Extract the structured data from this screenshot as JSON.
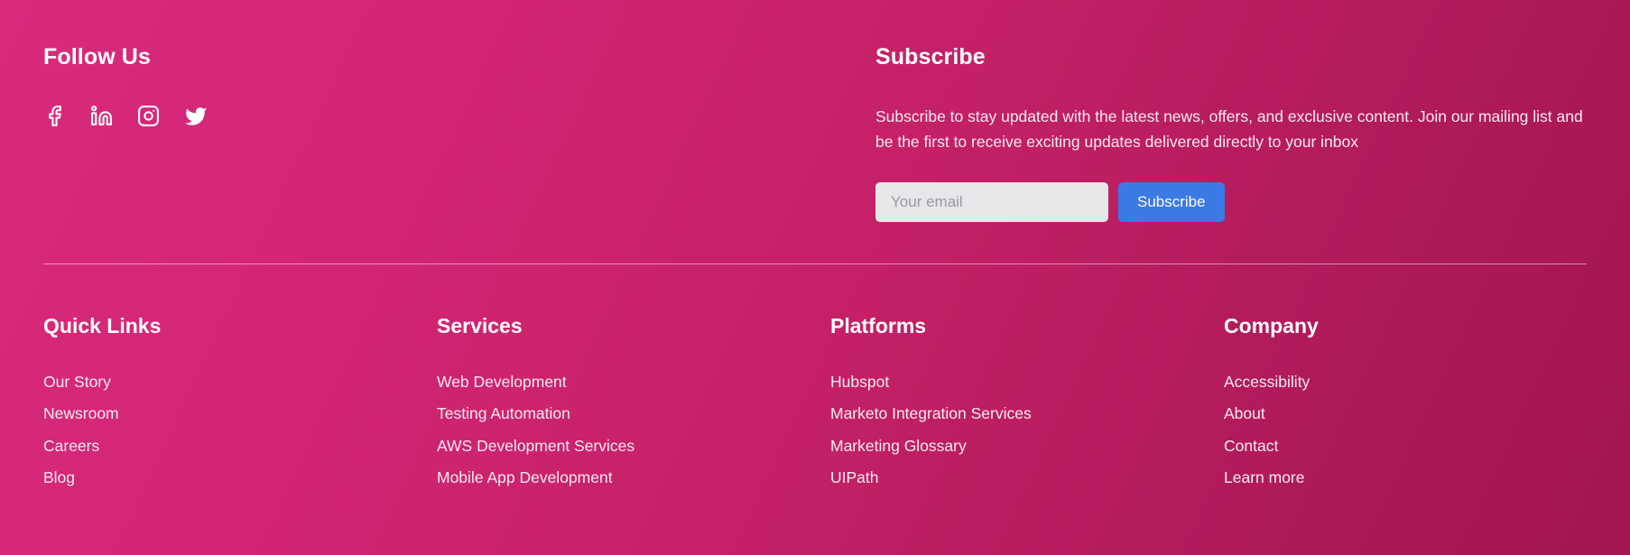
{
  "theme": {
    "bg_gradient_start": "#d92a7c",
    "bg_gradient_end": "#a21551",
    "text_color": "#ffffff",
    "link_color": "#fbeaf1",
    "button_color": "#3b7ae4",
    "input_bg": "#e6e7e9"
  },
  "follow": {
    "title": "Follow Us",
    "socials": [
      {
        "name": "facebook",
        "icon": "facebook-icon",
        "label": "Facebook"
      },
      {
        "name": "linkedin",
        "icon": "linkedin-icon",
        "label": "LinkedIn"
      },
      {
        "name": "instagram",
        "icon": "instagram-icon",
        "label": "Instagram"
      },
      {
        "name": "twitter",
        "icon": "twitter-icon",
        "label": "Twitter"
      }
    ]
  },
  "subscribe": {
    "title": "Subscribe",
    "description": "Subscribe to stay updated with the latest news, offers, and exclusive content. Join our mailing list and be the first to receive exciting updates delivered directly to your inbox",
    "email_placeholder": "Your email",
    "email_value": "",
    "button_label": "Subscribe"
  },
  "columns": [
    {
      "title": "Quick Links",
      "links": [
        "Our Story",
        "Newsroom",
        "Careers",
        "Blog"
      ]
    },
    {
      "title": "Services",
      "links": [
        "Web Development",
        "Testing Automation",
        "AWS Development Services",
        "Mobile App Development"
      ]
    },
    {
      "title": "Platforms",
      "links": [
        "Hubspot",
        "Marketo Integration Services",
        "Marketing Glossary",
        "UIPath"
      ]
    },
    {
      "title": "Company",
      "links": [
        "Accessibility",
        "About",
        "Contact",
        "Learn more"
      ]
    }
  ]
}
